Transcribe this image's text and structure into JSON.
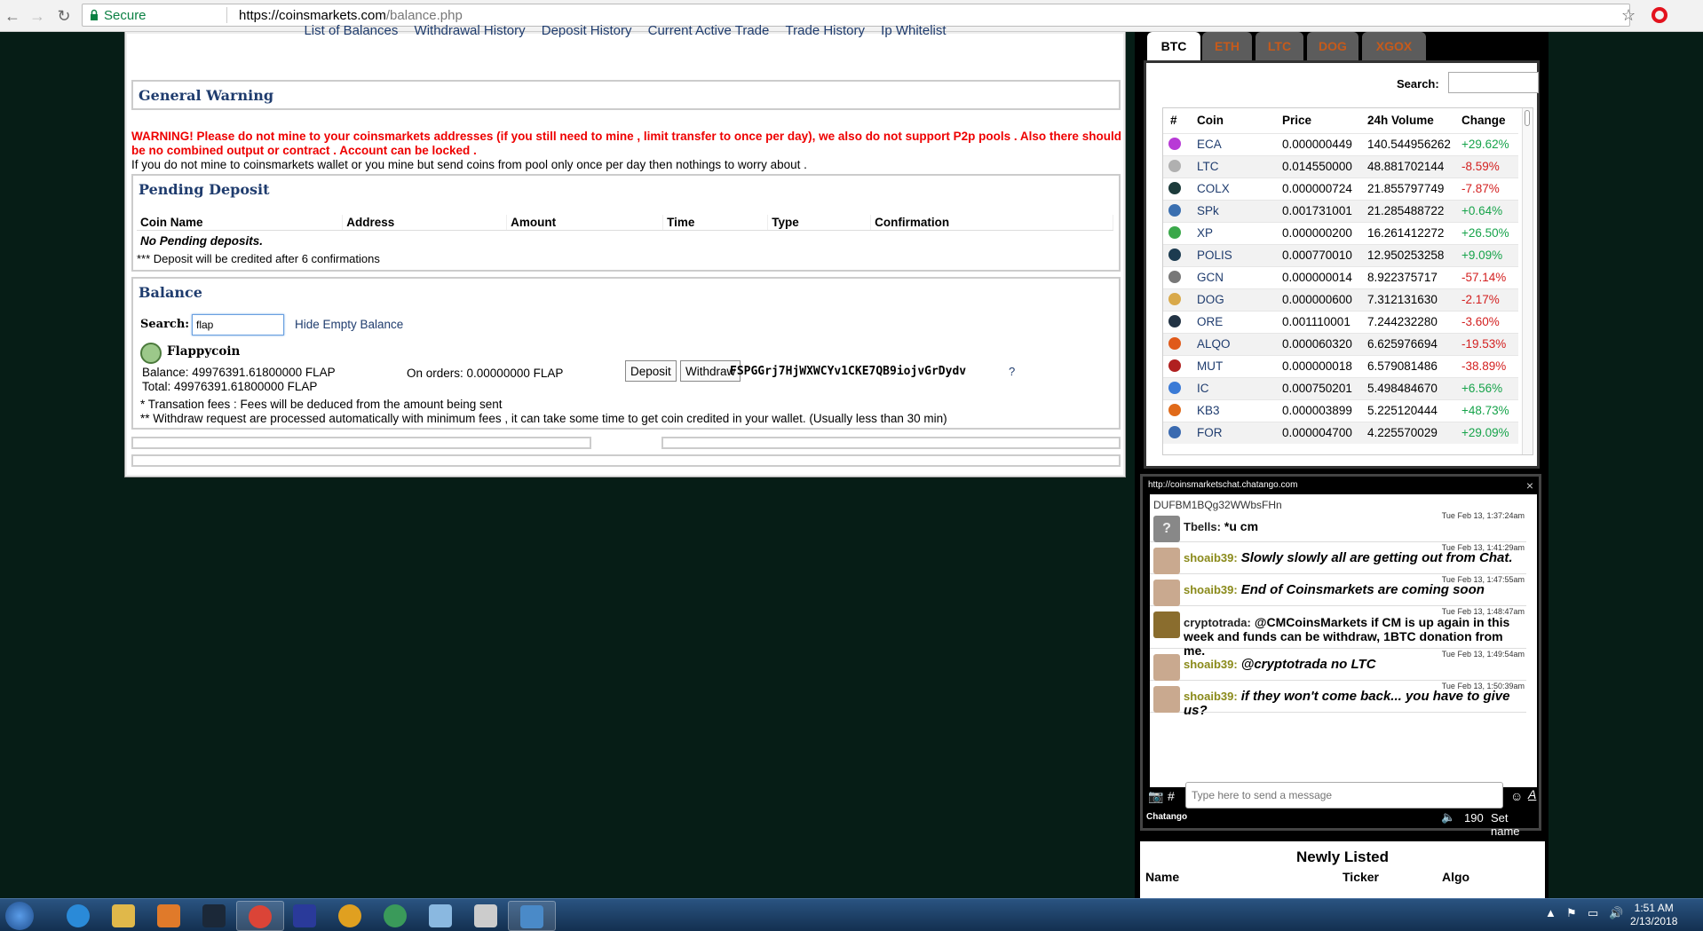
{
  "browser": {
    "secure_label": "Secure",
    "url_host": "https://coinsmarkets.com",
    "url_path": "/balance.php"
  },
  "nav_links": [
    "List of Balances",
    "Withdrawal History",
    "Deposit History",
    "Current Active Trade",
    "Trade History",
    "Ip Whitelist"
  ],
  "general_warning": {
    "title": "General Warning",
    "warning": "WARNING! Please do not mine to your coinsmarkets addresses (if you still need to mine , limit transfer to once per day), we also do not support P2p pools . Also there should be no combined output or contract . Account can be locked .",
    "note": "If you do not mine to coinsmarkets wallet or you mine but send coins from pool only once per day then nothings to worry about ."
  },
  "pending_deposit": {
    "title": "Pending Deposit",
    "columns": [
      "Coin Name",
      "Address",
      "Amount",
      "Time",
      "Type",
      "Confirmation"
    ],
    "empty": "No Pending deposits.",
    "note": "*** Deposit will be credited after 6 confirmations"
  },
  "balance": {
    "title": "Balance",
    "search_label": "Search:",
    "search_value": "flap",
    "hide_empty": "Hide Empty Balance",
    "coin_name": "Flappycoin",
    "balance_line": "Balance: 49976391.61800000 FLAP",
    "total_line": "Total: 49976391.61800000 FLAP",
    "on_orders": "On orders: 0.00000000 FLAP",
    "deposit_label": "Deposit",
    "withdraw_label": "Withdraw",
    "address": "FSPGGrj7HjWXWCYv1CKE7QB9iojvGrDydv",
    "help": "?",
    "note1": "* Transation fees : Fees will be deduced from the amount being sent",
    "note2": "** Withdraw request are processed automatically with minimum fees , it can take some time to get coin credited in your wallet. (Usually less than 30 min)"
  },
  "market": {
    "tabs": [
      "BTC",
      "ETH",
      "LTC",
      "DOG",
      "XGOX"
    ],
    "active_tab": "BTC",
    "search_label": "Search:",
    "columns": [
      "#",
      "Coin",
      "Price",
      "24h Volume",
      "Change"
    ],
    "rows": [
      {
        "coin": "ECA",
        "price": "0.000000449",
        "volume": "140.544956262",
        "change": "+29.62%",
        "dir": "pos",
        "color": "#b83ad6"
      },
      {
        "coin": "LTC",
        "price": "0.014550000",
        "volume": "48.881702144",
        "change": "-8.59%",
        "dir": "neg",
        "color": "#b0b0b0"
      },
      {
        "coin": "COLX",
        "price": "0.000000724",
        "volume": "21.855797749",
        "change": "-7.87%",
        "dir": "neg",
        "color": "#1c3b3b"
      },
      {
        "coin": "SPk",
        "price": "0.001731001",
        "volume": "21.285488722",
        "change": "+0.64%",
        "dir": "pos",
        "color": "#3a6fb0"
      },
      {
        "coin": "XP",
        "price": "0.000000200",
        "volume": "16.261412272",
        "change": "+26.50%",
        "dir": "pos",
        "color": "#3aa84a"
      },
      {
        "coin": "POLIS",
        "price": "0.000770010",
        "volume": "12.950253258",
        "change": "+9.09%",
        "dir": "pos",
        "color": "#1c3b50"
      },
      {
        "coin": "GCN",
        "price": "0.000000014",
        "volume": "8.922375717",
        "change": "-57.14%",
        "dir": "neg",
        "color": "#777777"
      },
      {
        "coin": "DOG",
        "price": "0.000000600",
        "volume": "7.312131630",
        "change": "-2.17%",
        "dir": "neg",
        "color": "#d9a94a"
      },
      {
        "coin": "ORE",
        "price": "0.001110001",
        "volume": "7.244232280",
        "change": "-3.60%",
        "dir": "neg",
        "color": "#223344"
      },
      {
        "coin": "ALQO",
        "price": "0.000060320",
        "volume": "6.625976694",
        "change": "-19.53%",
        "dir": "neg",
        "color": "#e05a1a"
      },
      {
        "coin": "MUT",
        "price": "0.000000018",
        "volume": "6.579081486",
        "change": "-38.89%",
        "dir": "neg",
        "color": "#b02020"
      },
      {
        "coin": "IC",
        "price": "0.000750201",
        "volume": "5.498484670",
        "change": "+6.56%",
        "dir": "pos",
        "color": "#3a7ad6"
      },
      {
        "coin": "KB3",
        "price": "0.000003899",
        "volume": "5.225120444",
        "change": "+48.73%",
        "dir": "pos",
        "color": "#e06a1a"
      },
      {
        "coin": "FOR",
        "price": "0.000004700",
        "volume": "4.225570029",
        "change": "+29.09%",
        "dir": "pos",
        "color": "#3a6ab0"
      }
    ]
  },
  "chat": {
    "url": "http://coinsmarketschat.chatango.com",
    "close": "×",
    "partial": "DUFBM1BQg32WWbsFHn",
    "messages": [
      {
        "time": "Tue Feb 13, 1:37:24am",
        "user": "Tbells:",
        "text": "*u cm",
        "avatar": "gray",
        "style": "plain"
      },
      {
        "time": "Tue Feb 13, 1:41:29am",
        "user": "shoaib39:",
        "text": "Slowly slowly all are getting out from Chat.",
        "avatar": "face",
        "style": "italic"
      },
      {
        "time": "Tue Feb 13, 1:47:55am",
        "user": "shoaib39:",
        "text": "End of Coinsmarkets are coming soon",
        "avatar": "face",
        "style": "italic"
      },
      {
        "time": "Tue Feb 13, 1:48:47am",
        "user": "cryptotrada:",
        "text": "@CMCoinsMarkets if CM is up again in this week and funds can be withdraw, 1BTC donation from me.",
        "avatar": "gold",
        "style": "plain"
      },
      {
        "time": "Tue Feb 13, 1:49:54am",
        "user": "shoaib39:",
        "text": "@cryptotrada no LTC",
        "avatar": "face",
        "style": "italic"
      },
      {
        "time": "Tue Feb 13, 1:50:39am",
        "user": "shoaib39:",
        "text": "if they won't come back... you have to give us?",
        "avatar": "face",
        "style": "italic"
      }
    ],
    "input_placeholder": "Type here to send a message",
    "brand": "Chatango",
    "count": "190",
    "set_name": "Set name"
  },
  "newly_listed": {
    "title": "Newly Listed",
    "columns": [
      "Name",
      "Ticker",
      "Algo"
    ]
  },
  "taskbar": {
    "time": "1:51 AM",
    "date": "2/13/2018",
    "apps": [
      {
        "name": "internet-explorer",
        "color": "#2a8ad8"
      },
      {
        "name": "file-explorer",
        "color": "#e0b84a"
      },
      {
        "name": "media-player",
        "color": "#e07a2a"
      },
      {
        "name": "steam",
        "color": "#1b2838"
      },
      {
        "name": "chrome",
        "color": "#db4437"
      },
      {
        "name": "shield-app",
        "color": "#2a3a9a"
      },
      {
        "name": "wallet-app",
        "color": "#e0a020"
      },
      {
        "name": "globe-app",
        "color": "#3a9a5a"
      },
      {
        "name": "notepad",
        "color": "#8ab8e0"
      },
      {
        "name": "calculator",
        "color": "#cccccc"
      },
      {
        "name": "coinmate-app",
        "color": "#4a8ac8"
      }
    ]
  }
}
